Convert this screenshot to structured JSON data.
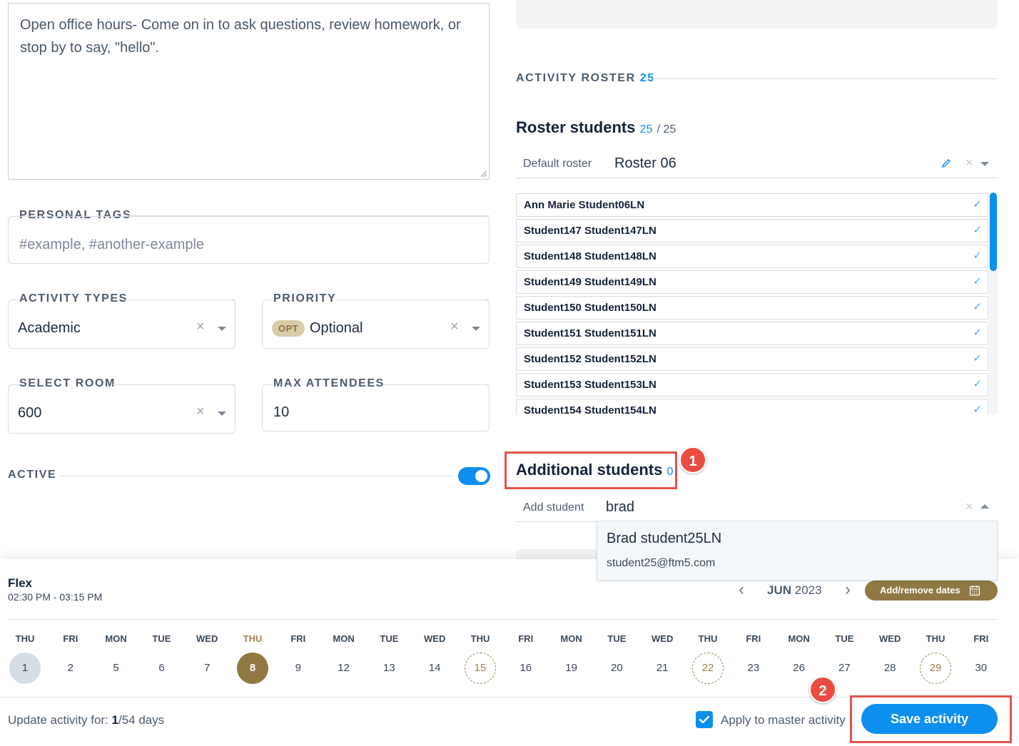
{
  "form": {
    "description": "Open office hours- Come on in to ask questions, review homework, or stop by to say, \"hello\".",
    "personal_tags": {
      "label": "PERSONAL TAGS",
      "placeholder": "#example, #another-example"
    },
    "activity_types": {
      "label": "ACTIVITY TYPES",
      "value": "Academic"
    },
    "priority": {
      "label": "PRIORITY",
      "badge": "OPT",
      "value": "Optional"
    },
    "select_room": {
      "label": "SELECT ROOM",
      "value": "600"
    },
    "max_attendees": {
      "label": "MAX ATTENDEES",
      "value": "10"
    },
    "active": {
      "label": "ACTIVE",
      "on": true
    }
  },
  "roster": {
    "section_label": "ACTIVITY ROSTER",
    "section_count": "25",
    "title": "Roster students",
    "count": "25",
    "total": "/ 25",
    "default_roster_label": "Default roster",
    "default_roster_value": "Roster 06",
    "students": [
      "Ann Marie Student06LN",
      "Student147 Student147LN",
      "Student148 Student148LN",
      "Student149 Student149LN",
      "Student150 Student150LN",
      "Student151 Student151LN",
      "Student152 Student152LN",
      "Student153 Student153LN",
      "Student154 Student154LN"
    ],
    "check_glyph": "✓"
  },
  "additional": {
    "title": "Additional students",
    "count": "0",
    "add_label": "Add student",
    "search_value": "brad",
    "result_name": "Brad student25LN",
    "result_email": "student25@ftm5.com"
  },
  "annotations": {
    "one": "1",
    "two": "2",
    "accent": "#e2534a"
  },
  "schedule": {
    "period": "Flex",
    "time": "02:30 PM - 03:15 PM",
    "month": "JUN",
    "year": "2023",
    "add_remove_label": "Add/remove dates",
    "days": [
      {
        "name": "THU",
        "num": "1",
        "state": "grey"
      },
      {
        "name": "FRI",
        "num": "2",
        "state": ""
      },
      {
        "name": "MON",
        "num": "5",
        "state": ""
      },
      {
        "name": "TUE",
        "num": "6",
        "state": ""
      },
      {
        "name": "WED",
        "num": "7",
        "state": ""
      },
      {
        "name": "THU",
        "num": "8",
        "state": "gold"
      },
      {
        "name": "FRI",
        "num": "9",
        "state": ""
      },
      {
        "name": "MON",
        "num": "12",
        "state": ""
      },
      {
        "name": "TUE",
        "num": "13",
        "state": ""
      },
      {
        "name": "WED",
        "num": "14",
        "state": ""
      },
      {
        "name": "THU",
        "num": "15",
        "state": "dashed"
      },
      {
        "name": "FRI",
        "num": "16",
        "state": ""
      },
      {
        "name": "MON",
        "num": "19",
        "state": ""
      },
      {
        "name": "TUE",
        "num": "20",
        "state": ""
      },
      {
        "name": "WED",
        "num": "21",
        "state": ""
      },
      {
        "name": "THU",
        "num": "22",
        "state": "dashed"
      },
      {
        "name": "FRI",
        "num": "23",
        "state": ""
      },
      {
        "name": "MON",
        "num": "26",
        "state": ""
      },
      {
        "name": "TUE",
        "num": "27",
        "state": ""
      },
      {
        "name": "WED",
        "num": "28",
        "state": ""
      },
      {
        "name": "THU",
        "num": "29",
        "state": "dashed"
      },
      {
        "name": "FRI",
        "num": "30",
        "state": ""
      }
    ]
  },
  "footer": {
    "update_prefix": "Update activity for: ",
    "update_current": "1",
    "update_suffix": "/54 days",
    "apply_label": "Apply to master activity",
    "apply_checked": true,
    "save_label": "Save activity"
  },
  "glyphs": {
    "clear": "×",
    "prev": "‹",
    "next": "›"
  }
}
